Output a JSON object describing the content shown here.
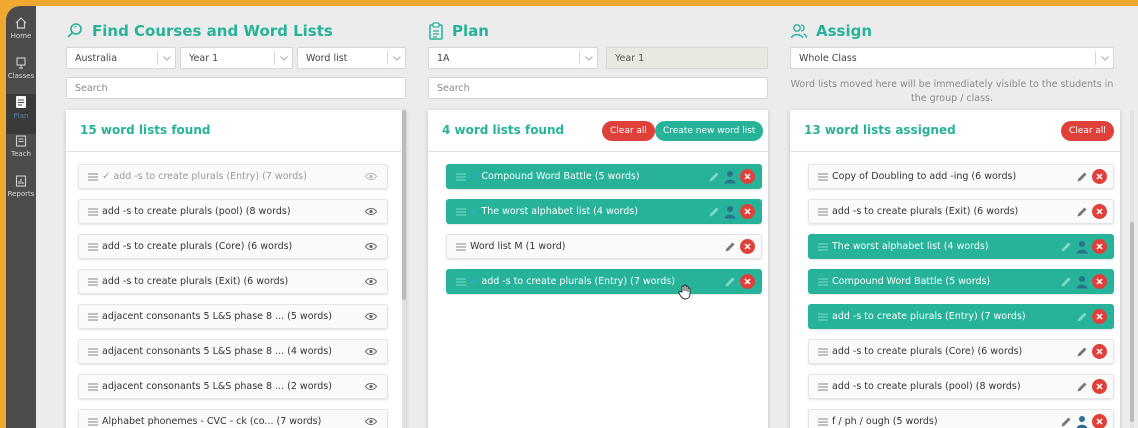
{
  "sidebar": {
    "items": [
      {
        "label": "Home",
        "icon": "home-icon"
      },
      {
        "label": "Classes",
        "icon": "classes-icon"
      },
      {
        "label": "Plan",
        "icon": "plan-icon"
      },
      {
        "label": "Teach",
        "icon": "teach-icon"
      },
      {
        "label": "Reports",
        "icon": "reports-icon"
      }
    ]
  },
  "find": {
    "title": "Find Courses and Word Lists",
    "country": "Australia",
    "year": "Year 1",
    "type": "Word list",
    "search_placeholder": "Search",
    "count": "15 word lists found",
    "items": [
      {
        "label": "add -s to create plurals (Entry) (7 words)",
        "checked": true,
        "faded": true
      },
      {
        "label": "add -s to create plurals (pool) (8 words)"
      },
      {
        "label": "add -s to create plurals (Core) (6 words)"
      },
      {
        "label": "add -s to create plurals (Exit) (6 words)"
      },
      {
        "label": "adjacent consonants 5 L&S phase 8 ... (5 words)"
      },
      {
        "label": "adjacent consonants 5 L&S phase 8 ... (4 words)"
      },
      {
        "label": "adjacent consonants 5 L&S phase 8 ... (2 words)"
      },
      {
        "label": "Alphabet phonemes - CVC - ck (co... (7 words)"
      }
    ]
  },
  "plan": {
    "title": "Plan",
    "class": "1A",
    "year": "Year 1",
    "search_placeholder": "Search",
    "count": "4 word lists found",
    "clear_label": "Clear all",
    "create_label": "Create new word list",
    "items": [
      {
        "label": "Compound Word Battle (5 words)",
        "green": true,
        "checked": true,
        "assigned": true
      },
      {
        "label": "The worst alphabet list (4 words)",
        "green": true,
        "checked": true,
        "assigned": true
      },
      {
        "label": "Word list M (1 word)",
        "green": false,
        "checked": false,
        "assigned": false
      },
      {
        "label": "add -s to create plurals (Entry) (7 words)",
        "green": true,
        "checked": true,
        "assigned": false
      }
    ]
  },
  "assign": {
    "title": "Assign",
    "group": "Whole Class",
    "note": "Word lists moved here will be immediately visible to the students in the group / class.",
    "count": "13 word lists assigned",
    "clear_label": "Clear all",
    "items": [
      {
        "label": "Copy of Doubling to add -ing (6 words)",
        "green": false,
        "assigned": false
      },
      {
        "label": "add -s to create plurals (Exit) (6 words)",
        "green": false,
        "assigned": false
      },
      {
        "label": "The worst alphabet list (4 words)",
        "green": true,
        "assigned": true
      },
      {
        "label": "Compound Word Battle (5 words)",
        "green": true,
        "assigned": true
      },
      {
        "label": "add -s to create plurals (Entry) (7 words)",
        "green": true,
        "assigned": false
      },
      {
        "label": "add -s to create plurals (Core) (6 words)",
        "green": false,
        "assigned": false
      },
      {
        "label": "add -s to create plurals (pool) (8 words)",
        "green": false,
        "assigned": false
      },
      {
        "label": "f / ph / ough (5 words)",
        "green": false,
        "assigned": true
      }
    ]
  },
  "colors": {
    "accent": "#26b399",
    "danger": "#e0403a",
    "frame": "#f0a830",
    "sidebar": "#4c4c4c"
  }
}
